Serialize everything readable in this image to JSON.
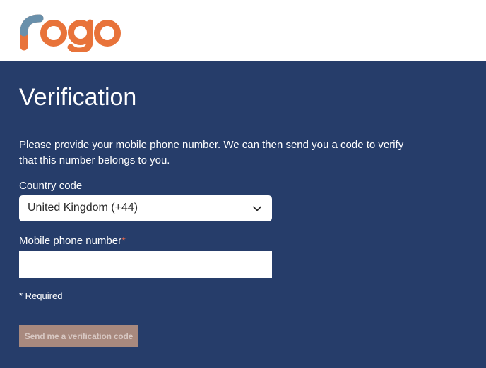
{
  "colors": {
    "header_bg": "#ffffff",
    "panel_bg": "#263d6a",
    "logo_orange": "#e8733a",
    "logo_blue": "#5b93b8",
    "required_red": "#e0654a",
    "button_bg": "#a8897e",
    "button_text": "#d8c8c3"
  },
  "header": {
    "logo_text": "rogo",
    "logo_icon": "rogo-logo-icon"
  },
  "main": {
    "title": "Verification",
    "description": "Please provide your mobile phone number. We can then send you a code to verify that this number belongs to you."
  },
  "form": {
    "country": {
      "label": "Country code",
      "selected": "United Kingdom (+44)",
      "icon": "chevron-down-icon"
    },
    "phone": {
      "label": "Mobile phone number",
      "required_marker": "*",
      "value": "",
      "placeholder": ""
    },
    "required_note": "* Required",
    "submit_label": "Send me a verification code",
    "submit_disabled": true
  }
}
